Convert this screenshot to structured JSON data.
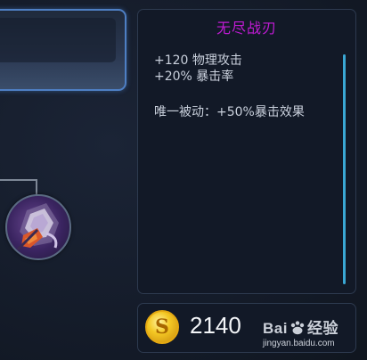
{
  "item": {
    "name": "无尽战刃",
    "stats": [
      "+120 物理攻击",
      "+20% 暴击率"
    ],
    "passive": "唯一被动：+50%暴击效果",
    "price": "2140"
  },
  "currency": {
    "symbol": "S",
    "icon": "gold-coin-icon"
  },
  "watermark": {
    "logo_left": "Bai",
    "logo_right": "经验",
    "url": "jingyan.baidu.com"
  },
  "colors": {
    "item_name": "#c21bd6",
    "accent_border": "#4e7fc4",
    "scrollbar": "#3aa7d4",
    "background": "#141b29"
  }
}
